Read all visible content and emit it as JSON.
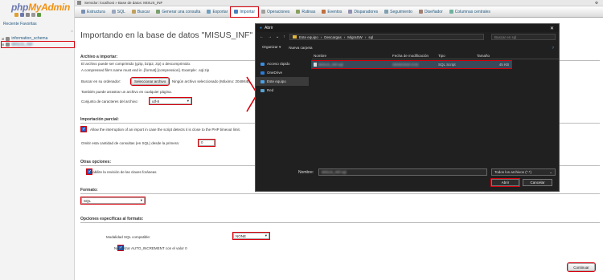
{
  "colors": {
    "highlight": "#d8000c",
    "link": "#235a81",
    "brand_php": "#6c78af",
    "brand_myadmin": "#f29111"
  },
  "sidebar": {
    "logo_php": "php",
    "logo_myadmin": "MyAdmin",
    "nav_links": "Reciente  Favoritas",
    "databases": [
      {
        "name": "information_schema",
        "icon": "database-icon"
      },
      {
        "name": "MISUS_INF",
        "icon": "database-icon"
      }
    ]
  },
  "server_bar": {
    "text": "Servidor: localhost » Base de datos: MISUS_INF"
  },
  "tabs": [
    {
      "label": "Estructura",
      "icon": "table-icon"
    },
    {
      "label": "SQL",
      "icon": "sql-icon"
    },
    {
      "label": "Buscar",
      "icon": "search-icon"
    },
    {
      "label": "Generar una consulta",
      "icon": "query-icon"
    },
    {
      "label": "Exportar",
      "icon": "export-icon"
    },
    {
      "label": "Importar",
      "icon": "import-icon",
      "active": true
    },
    {
      "label": "Operaciones",
      "icon": "wrench-icon"
    },
    {
      "label": "Rutinas",
      "icon": "routine-icon"
    },
    {
      "label": "Eventos",
      "icon": "clock-icon"
    },
    {
      "label": "Disparadores",
      "icon": "trigger-icon"
    },
    {
      "label": "Seguimiento",
      "icon": "eye-icon"
    },
    {
      "label": "Diseñador",
      "icon": "designer-icon"
    },
    {
      "label": "Columnas centrales",
      "icon": "columns-icon"
    }
  ],
  "main": {
    "title": "Importando en la base de datos \"MISUS_INF\"",
    "file_section": {
      "heading": "Archivo a importar:",
      "line1": "El archivo puede ser comprimido (gzip, bzip2, zip) o descomprimido.",
      "line2": "A compressed file's name must end in .[format].[compression]. Example: .sql.zip",
      "browse_label": "Buscar en su ordenador:",
      "browse_button": "Seleccionar archivo",
      "no_file": "Ningún archivo seleccionado (Máximo: 2048KiB)",
      "drag_hint": "También puede arrastrar un archivo en cualquier página.",
      "charset_label": "Conjunto de caracteres del archivo:",
      "charset_value": "utf-8"
    },
    "partial_section": {
      "heading": "Importación parcial:",
      "allow_interrupt": "Allow the interruption of an import in case the script detects it is close to the PHP timeout limit.",
      "skip_label": "Omitir esta cantidad de consultas (en SQL) desde la primera:",
      "skip_value": "0"
    },
    "other_section": {
      "heading": "Otras opciones:",
      "foreign_keys": "Habilite la revisión de las claves foráneas"
    },
    "format_section": {
      "heading": "Formato:",
      "value": "SQL"
    },
    "specific_section": {
      "heading": "Opciones específicas al formato:",
      "compat_label": "Modalidad SQL compatible:",
      "compat_value": "NONE",
      "auto_increment": "No utilizar AUTO_INCREMENT con el valor 0"
    },
    "submit": "Continuar"
  },
  "dialog": {
    "title": "Abrir",
    "path": [
      "Este equipo",
      "Descargas",
      "MigraSW",
      "sql"
    ],
    "search_placeholder": "Buscar en sql",
    "organize": "Organizar ▾",
    "new_folder": "Nueva carpeta",
    "sidebar": [
      {
        "label": "Acceso rápido",
        "icon": "star-icon"
      },
      {
        "label": "OneDrive",
        "icon": "cloud-icon"
      },
      {
        "label": "Este equipo",
        "icon": "computer-icon",
        "selected": true
      },
      {
        "label": "Red",
        "icon": "network-icon"
      }
    ],
    "columns": [
      "Nombre",
      "Fecha de modificación",
      "Tipo",
      "Tamaño"
    ],
    "file": {
      "name": "MISUS_INF.sql",
      "date": "06/06/2020 9:02",
      "type": "SQL Script",
      "size": "45 KB"
    },
    "filename_label": "Nombre:",
    "filename_value": "MISUS_INF.sql",
    "filter": "Todos los archivos (*.*)",
    "open_button": "Abrir",
    "cancel_button": "Cancelar"
  }
}
